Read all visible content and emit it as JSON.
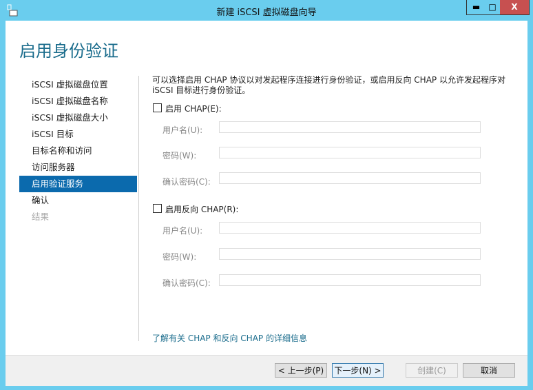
{
  "window": {
    "title": "新建 iSCSI 虚拟磁盘向导",
    "minimize": "▬",
    "maximize": "□",
    "close": "X"
  },
  "heading": "启用身份验证",
  "nav": [
    {
      "label": "iSCSI 虚拟磁盘位置",
      "state": "normal"
    },
    {
      "label": "iSCSI 虚拟磁盘名称",
      "state": "normal"
    },
    {
      "label": "iSCSI 虚拟磁盘大小",
      "state": "normal"
    },
    {
      "label": "iSCSI 目标",
      "state": "normal"
    },
    {
      "label": "目标名称和访问",
      "state": "normal"
    },
    {
      "label": "访问服务器",
      "state": "normal"
    },
    {
      "label": "启用验证服务",
      "state": "active"
    },
    {
      "label": "确认",
      "state": "normal"
    },
    {
      "label": "结果",
      "state": "disabled"
    }
  ],
  "description": "可以选择启用 CHAP 协议以对发起程序连接进行身份验证，或启用反向 CHAP 以允许发起程序对 iSCSI 目标进行身份验证。",
  "chap": {
    "label": "启用 CHAP(E):",
    "checked": false,
    "username_label": "用户名(U):",
    "password_label": "密码(W):",
    "confirm_label": "确认密码(C):",
    "username": "",
    "password": "",
    "confirm": ""
  },
  "reverse_chap": {
    "label": "启用反向 CHAP(R):",
    "checked": false,
    "username_label": "用户名(U):",
    "password_label": "密码(W):",
    "confirm_label": "确认密码(C):",
    "username": "",
    "password": "",
    "confirm": ""
  },
  "link": "了解有关 CHAP 和反向 CHAP 的详细信息",
  "buttons": {
    "prev": "< 上一步(P)",
    "next": "下一步(N) >",
    "create": "创建(C)",
    "cancel": "取消"
  }
}
